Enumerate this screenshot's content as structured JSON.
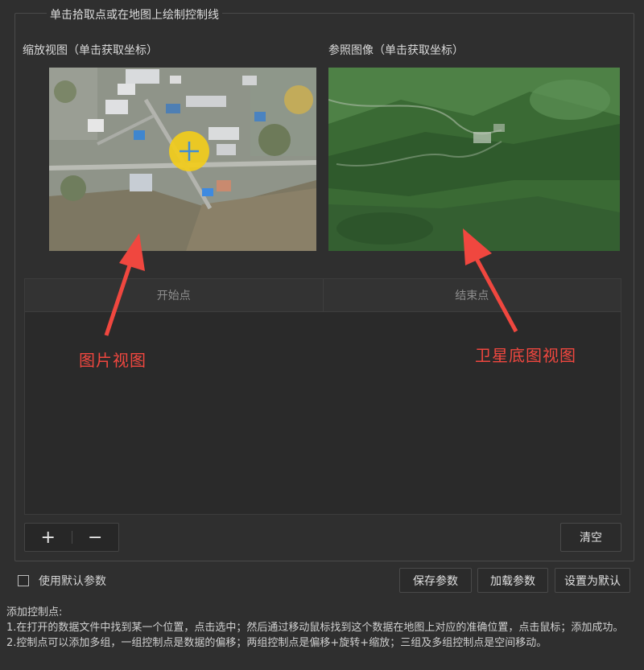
{
  "group": {
    "title": "单击拾取点或在地图上绘制控制线"
  },
  "zoom_view": {
    "label": "缩放视图（单击获取坐标）"
  },
  "reference_view": {
    "label": "参照图像（单击获取坐标）"
  },
  "table": {
    "columns": [
      "开始点",
      "结束点"
    ],
    "rows": []
  },
  "buttons": {
    "add": "+",
    "remove": "−",
    "clear": "清空",
    "save_params": "保存参数",
    "load_params": "加载参数",
    "set_default": "设置为默认"
  },
  "use_default": {
    "label": "使用默认参数",
    "checked": false
  },
  "help": {
    "title": "添加控制点:",
    "line1": "1.在打开的数据文件中找到某一个位置，点击选中；然后通过移动鼠标找到这个数据在地图上对应的准确位置，点击鼠标；添加成功。",
    "line2": "2.控制点可以添加多组，一组控制点是数据的偏移；两组控制点是偏移+旋转+缩放；三组及多组控制点是空间移动。"
  },
  "annotations": {
    "left": "图片视图",
    "right": "卫星底图视图",
    "color": "#f0473f"
  },
  "colors": {
    "background": "#2f2f2f",
    "marker": "#f2cc1b",
    "crosshair": "#3f8cd8"
  }
}
